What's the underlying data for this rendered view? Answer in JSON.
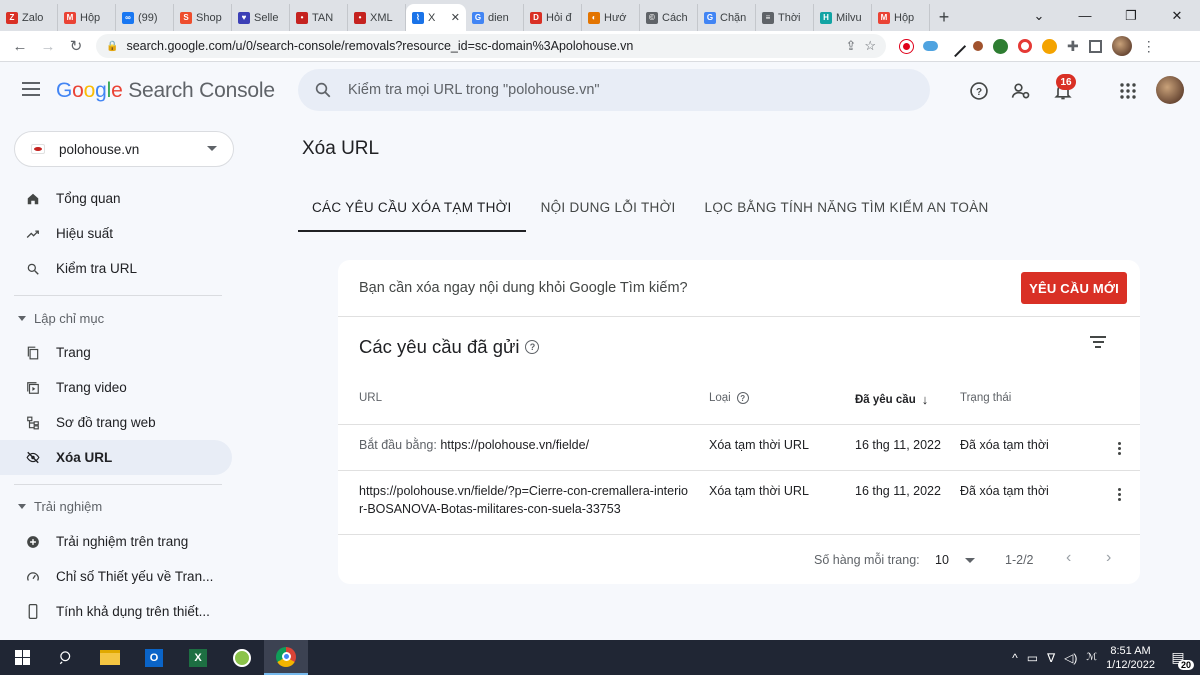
{
  "browser": {
    "tabs": [
      {
        "label": "Zalo",
        "color": "#d93025",
        "glyph": "Z"
      },
      {
        "label": "Hộp",
        "color": "#ea4335",
        "glyph": "M"
      },
      {
        "label": "(99)",
        "color": "#1877f2",
        "glyph": "∞"
      },
      {
        "label": "Shop",
        "color": "#ee4d2d",
        "glyph": "S"
      },
      {
        "label": "Selle",
        "color": "#3b3fb6",
        "glyph": "♥"
      },
      {
        "label": "TAN",
        "color": "#c5221f",
        "glyph": "•"
      },
      {
        "label": "XML",
        "color": "#c5221f",
        "glyph": "•"
      },
      {
        "label": "X",
        "color": "#1a73e8",
        "glyph": "⌇",
        "active": true
      },
      {
        "label": "dien",
        "color": "#4285f4",
        "glyph": "G"
      },
      {
        "label": "Hỏi đ",
        "color": "#d93025",
        "glyph": "D"
      },
      {
        "label": "Hướ",
        "color": "#e37400",
        "glyph": "◐"
      },
      {
        "label": "Cách",
        "color": "#5f6368",
        "glyph": "©"
      },
      {
        "label": "Chặn",
        "color": "#4285f4",
        "glyph": "G"
      },
      {
        "label": "Thời",
        "color": "#5f6368",
        "glyph": "≡"
      },
      {
        "label": "Milvu",
        "color": "#12a4a4",
        "glyph": "H"
      },
      {
        "label": "Hộp",
        "color": "#ea4335",
        "glyph": "M"
      }
    ],
    "new_tab_glyph": "+",
    "url": "search.google.com/u/0/search-console/removals?resource_id=sc-domain%3Apolohouse.vn"
  },
  "header": {
    "brand_google": [
      "G",
      "o",
      "o",
      "g",
      "l",
      "e"
    ],
    "brand_product": "Search Console",
    "search_placeholder": "Kiểm tra mọi URL trong \"polohouse.vn\"",
    "notifications_count": "16"
  },
  "sidebar": {
    "property": "polohouse.vn",
    "items_top": [
      {
        "label": "Tổng quan",
        "icon": "home-icon"
      },
      {
        "label": "Hiệu suất",
        "icon": "trending-icon"
      },
      {
        "label": "Kiểm tra URL",
        "icon": "search-icon"
      }
    ],
    "section_index": "Lập chỉ mục",
    "items_index": [
      {
        "label": "Trang",
        "icon": "pages-icon"
      },
      {
        "label": "Trang video",
        "icon": "video-icon"
      },
      {
        "label": "Sơ đồ trang web",
        "icon": "sitemap-icon"
      },
      {
        "label": "Xóa URL",
        "icon": "eye-off-icon",
        "active": true
      }
    ],
    "section_experience": "Trải nghiệm",
    "items_experience": [
      {
        "label": "Trải nghiệm trên trang",
        "icon": "plus-circle-icon"
      },
      {
        "label": "Chỉ số Thiết yếu về Tran...",
        "icon": "gauge-icon"
      },
      {
        "label": "Tính khả dụng trên thiết...",
        "icon": "phone-icon"
      }
    ]
  },
  "main": {
    "title": "Xóa URL",
    "tabs": [
      {
        "label": "CÁC YÊU CẦU XÓA TẠM THỜI",
        "active": true
      },
      {
        "label": "NỘI DUNG LỖI THỜI"
      },
      {
        "label": "LỌC BẰNG TÍNH NĂNG TÌM KIẾM AN TOÀN"
      }
    ],
    "banner_text": "Bạn cần xóa ngay nội dung khỏi Google Tìm kiếm?",
    "new_request_button": "YÊU CẦU MỚI",
    "list_title": "Các yêu cầu đã gửi",
    "columns": {
      "url": "URL",
      "type": "Loại",
      "requested": "Đã yêu cầu",
      "status": "Trạng thái"
    },
    "rows": [
      {
        "prefix": "Bắt đầu bằng:",
        "url": "https://polohouse.vn/fielde/",
        "type": "Xóa tạm thời URL",
        "date": "16 thg 11, 2022",
        "status": "Đã xóa tạm thời"
      },
      {
        "prefix": "",
        "url": "https://polohouse.vn/fielde/?p=Cierre-con-cremallera-interior-BOSANOVA-Botas-militares-con-suela-33753",
        "url_line1": "https://polohouse.vn/fielde/?p=Cierre-con-cremallera-interio",
        "url_line2": "r-BOSANOVA-Botas-militares-con-suela-33753",
        "type": "Xóa tạm thời URL",
        "date": "16 thg 11, 2022",
        "status": "Đã xóa tạm thời"
      }
    ],
    "pager": {
      "rows_per_page_label": "Số hàng mỗi trang:",
      "rows_per_page": "10",
      "range": "1-2/2"
    }
  },
  "taskbar": {
    "time": "8:51 AM",
    "date": "1/12/2022",
    "notification_count": "20"
  }
}
